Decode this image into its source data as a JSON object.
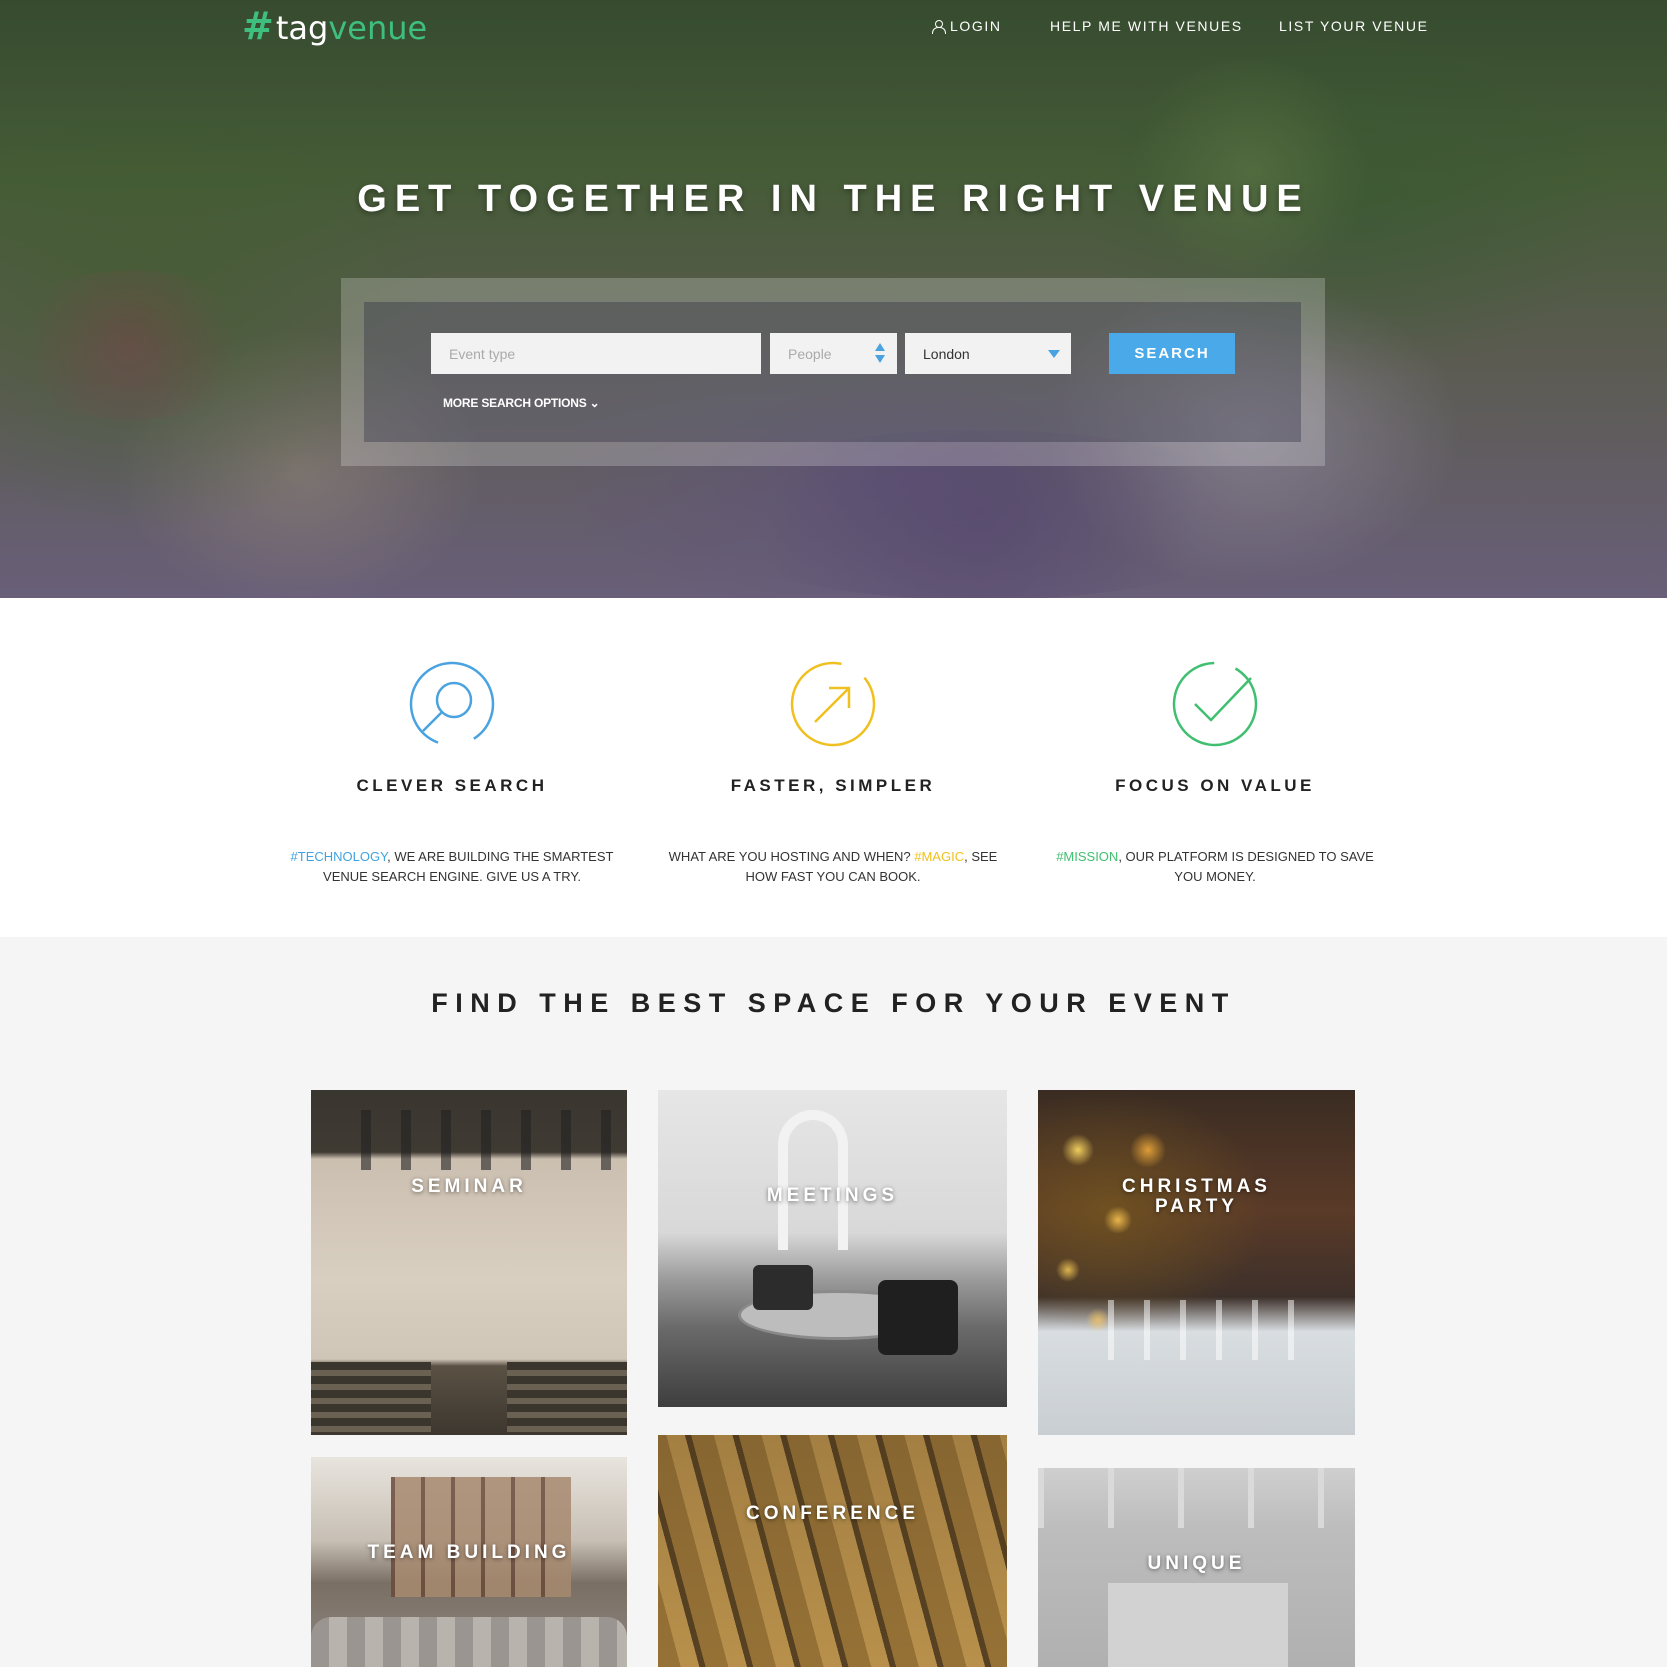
{
  "colors": {
    "brand_green": "#3fbf7f",
    "accent_blue": "#4aa9e8",
    "accent_yellow": "#f0c020",
    "accent_green": "#3fbf6f"
  },
  "header": {
    "logo": {
      "hash": "#",
      "tag": "tag",
      "venue": "venue"
    },
    "nav": {
      "login": "LOGIN",
      "help": "HELP ME WITH VENUES",
      "list": "LIST YOUR VENUE"
    },
    "login_icon": "user-icon"
  },
  "hero": {
    "title": "GET TOGETHER IN THE RIGHT VENUE",
    "search": {
      "event_placeholder": "Event type",
      "people_placeholder": "People",
      "city_value": "London",
      "button_label": "SEARCH",
      "more_options": "MORE SEARCH OPTIONS ⌄"
    }
  },
  "features": [
    {
      "icon": "search-icon",
      "title": "CLEVER SEARCH",
      "tag": "#TECHNOLOGY",
      "text_before": "",
      "text_after": ", WE ARE BUILDING THE SMARTEST VENUE SEARCH ENGINE. GIVE US A TRY."
    },
    {
      "icon": "arrow-up-right-icon",
      "title": "FASTER, SIMPLER",
      "tag": "#MAGIC",
      "text_before": "WHAT ARE YOU HOSTING AND WHEN? ",
      "text_after": ", SEE HOW FAST YOU CAN BOOK."
    },
    {
      "icon": "check-icon",
      "title": "FOCUS ON VALUE",
      "tag": "#MISSION",
      "text_before": "",
      "text_after": ", OUR PLATFORM IS DESIGNED TO SAVE YOU MONEY."
    }
  ],
  "categories": {
    "title": "FIND THE BEST SPACE FOR YOUR EVENT",
    "tiles": {
      "seminar": "SEMINAR",
      "meetings": "MEETINGS",
      "christmas_line1": "CHRISTMAS",
      "christmas_line2": "PARTY",
      "team_building": "TEAM BUILDING",
      "conference": "CONFERENCE",
      "unique": "UNIQUE"
    }
  }
}
